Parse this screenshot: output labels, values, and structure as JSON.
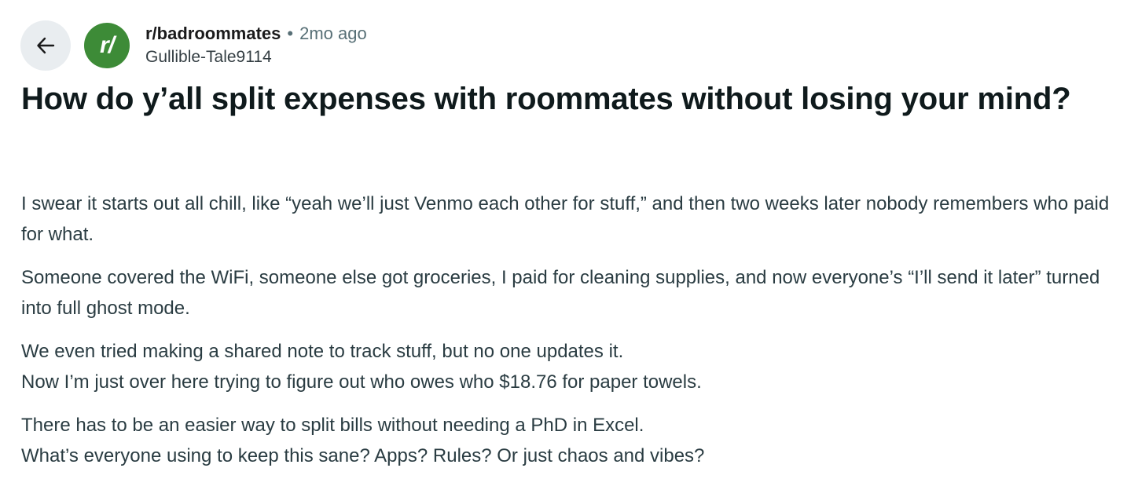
{
  "header": {
    "subreddit": "r/badroommates",
    "separator": "•",
    "time_ago": "2mo ago",
    "author": "Gullible-Tale9114",
    "avatar_text": "r/",
    "avatar_color": "#3d8b37",
    "back_icon": "arrow-left-icon"
  },
  "post": {
    "title": "How do y’all split expenses with roommates without losing your mind?",
    "paragraphs": [
      {
        "lines": [
          "I swear it starts out all chill, like “yeah we’ll just Venmo each other for stuff,” and then two weeks later nobody remembers who paid for what."
        ]
      },
      {
        "lines": [
          "Someone covered the WiFi, someone else got groceries, I paid for cleaning supplies, and now everyone’s “I’ll send it later” turned into full ghost mode."
        ]
      },
      {
        "lines": [
          "We even tried making a shared note to track stuff, but no one updates it.",
          "Now I’m just over here trying to figure out who owes who $18.76 for paper towels."
        ]
      },
      {
        "lines": [
          "There has to be an easier way to split bills without needing a PhD in Excel.",
          "What’s everyone using to keep this sane? Apps? Rules? Or just chaos and vibes?"
        ]
      }
    ]
  }
}
